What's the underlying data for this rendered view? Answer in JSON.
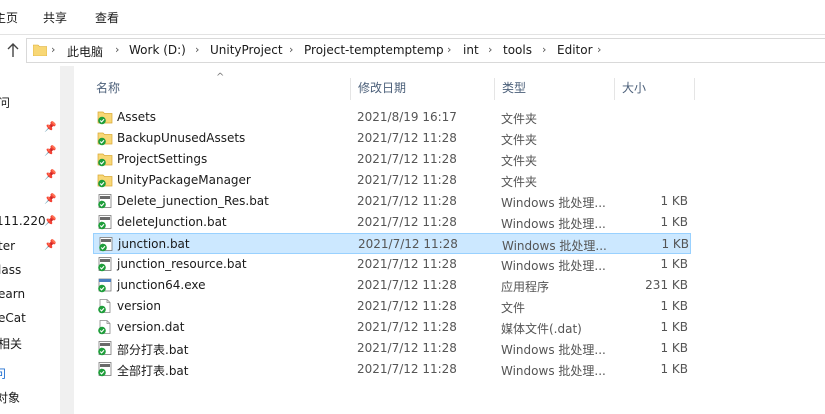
{
  "ribbon": {
    "tabs": [
      "主页",
      "共享",
      "查看"
    ]
  },
  "address": {
    "crumbs": [
      "此电脑",
      "Work (D:)",
      "UnityProject",
      "Project-temptemptemp",
      "int",
      "tools",
      "Editor"
    ]
  },
  "nav": {
    "items": [
      "问",
      "111.220",
      "ter",
      "lass",
      "earn",
      "eCat",
      "相关",
      "问",
      "对象"
    ]
  },
  "columns": {
    "name": "名称",
    "date": "修改日期",
    "type": "类型",
    "size": "大小"
  },
  "files": [
    {
      "name": "Assets",
      "date": "2021/8/19 16:17",
      "type": "文件夹",
      "size": "",
      "icon": "folder-sync-icon"
    },
    {
      "name": "BackupUnusedAssets",
      "date": "2021/7/12 11:28",
      "type": "文件夹",
      "size": "",
      "icon": "folder-sync-icon"
    },
    {
      "name": "ProjectSettings",
      "date": "2021/7/12 11:28",
      "type": "文件夹",
      "size": "",
      "icon": "folder-sync-icon"
    },
    {
      "name": "UnityPackageManager",
      "date": "2021/7/12 11:28",
      "type": "文件夹",
      "size": "",
      "icon": "folder-sync-icon"
    },
    {
      "name": "Delete_junection_Res.bat",
      "date": "2021/7/12 11:28",
      "type": "Windows 批处理...",
      "size": "1 KB",
      "icon": "bat-file-icon"
    },
    {
      "name": "deleteJunction.bat",
      "date": "2021/7/12 11:28",
      "type": "Windows 批处理...",
      "size": "1 KB",
      "icon": "bat-file-icon"
    },
    {
      "name": "junction.bat",
      "date": "2021/7/12 11:28",
      "type": "Windows 批处理...",
      "size": "1 KB",
      "icon": "bat-file-icon"
    },
    {
      "name": "junction_resource.bat",
      "date": "2021/7/12 11:28",
      "type": "Windows 批处理...",
      "size": "1 KB",
      "icon": "bat-file-icon"
    },
    {
      "name": "junction64.exe",
      "date": "2021/7/12 11:28",
      "type": "应用程序",
      "size": "231 KB",
      "icon": "exe-file-icon"
    },
    {
      "name": "version",
      "date": "2021/7/12 11:28",
      "type": "文件",
      "size": "1 KB",
      "icon": "plain-file-icon"
    },
    {
      "name": "version.dat",
      "date": "2021/7/12 11:28",
      "type": "媒体文件(.dat)",
      "size": "1 KB",
      "icon": "plain-file-icon"
    },
    {
      "name": "部分打表.bat",
      "date": "2021/7/12 11:28",
      "type": "Windows 批处理...",
      "size": "1 KB",
      "icon": "bat-file-icon"
    },
    {
      "name": "全部打表.bat",
      "date": "2021/7/12 11:28",
      "type": "Windows 批处理...",
      "size": "1 KB",
      "icon": "bat-file-icon"
    }
  ],
  "selected_index": 6,
  "colors": {
    "selection_bg": "#cce8ff",
    "selection_border": "#99d1ff",
    "header_text": "#4c607a",
    "folder_yellow": "#f8d775",
    "sync_green": "#1e9e3a"
  }
}
